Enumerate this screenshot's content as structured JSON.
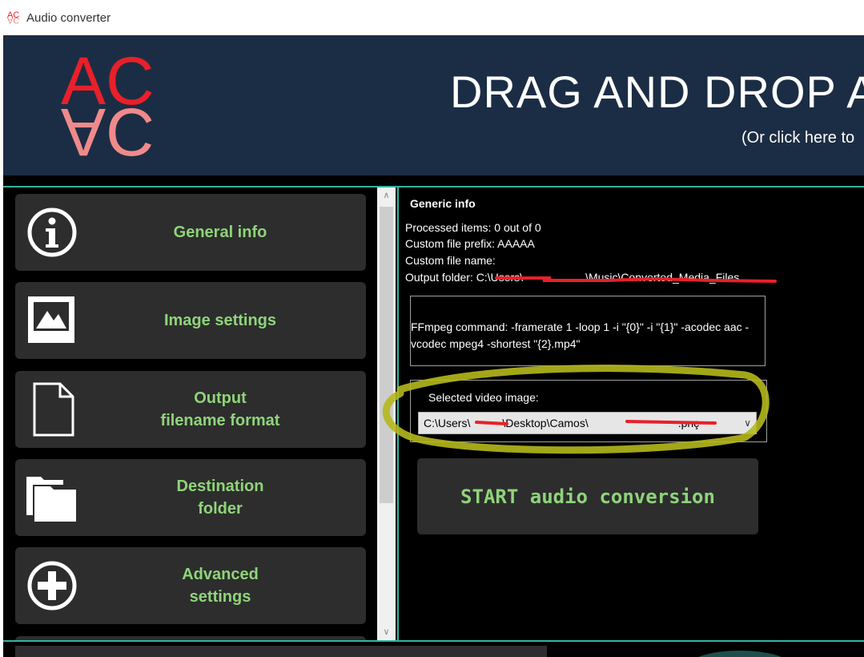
{
  "window": {
    "title": "Audio converter",
    "icon": "ac-logo-icon"
  },
  "header": {
    "logo_text": "AC",
    "drop_title": "DRAG AND DROP A",
    "drop_subtitle": "(Or click here to"
  },
  "sidebar": {
    "items": [
      {
        "label": "General info",
        "icon": "info-icon"
      },
      {
        "label": "Image settings",
        "icon": "image-icon"
      },
      {
        "label": "Output\nfilename format",
        "icon": "document-icon"
      },
      {
        "label": "Destination\nfolder",
        "icon": "folder-icon"
      },
      {
        "label": "Advanced\nsettings",
        "icon": "plus-circle-icon"
      }
    ]
  },
  "main": {
    "section_title": "Generic info",
    "processed_items": "Processed items: 0 out of 0",
    "custom_prefix": "Custom file prefix:  AAAAA",
    "custom_name": "Custom file name:",
    "output_folder": "Output folder:  C:\\Users\\",
    "output_folder_tail": "\\Music\\Converted_Media_Files",
    "ffmpeg_command": "FFmpeg command:  -framerate 1 -loop 1 -i \"{0}\" -i \"{1}\" -acodec aac -vcodec mpeg4 -shortest \"{2}.mp4\"",
    "selected_image_label": "Selected video image:",
    "selected_image_path_a": "C:\\Users\\",
    "selected_image_path_b": "\\Desktop\\Camos\\",
    "selected_image_path_c": ".pnç",
    "start_button": "START audio conversion"
  },
  "colors": {
    "header_bg": "#1b2d44",
    "accent_teal": "#33b4a3",
    "label_green": "#8fd47a",
    "logo_red": "#e8202a",
    "logo_pink": "#f08a8a",
    "highlight": "#b5b81c"
  }
}
